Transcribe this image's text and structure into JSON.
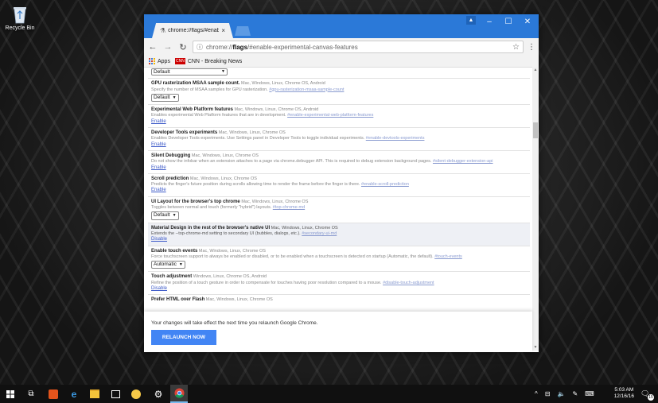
{
  "desktop": {
    "recycle_bin_label": "Recycle Bin"
  },
  "browser": {
    "tab_title": "chrome://flags/#enable",
    "url_prefix": "chrome://",
    "url_bold": "flags",
    "url_suffix": "/#enable-experimental-canvas-features",
    "bookmarks": {
      "apps_label": "Apps",
      "cnn_icon_text": "CNN",
      "cnn_label": "CNN - Breaking News"
    }
  },
  "flags": {
    "top_dropdown": "Default",
    "items": [
      {
        "name": "GPU rasterization MSAA sample count.",
        "platforms": "Mac, Windows, Linux, Chrome OS, Android",
        "desc": "Specify the number of MSAA samples for GPU rasterization.",
        "link": "#gpu-rasterization-msaa-sample-count",
        "control": "Default"
      },
      {
        "name": "Experimental Web Platform features",
        "platforms": "Mac, Windows, Linux, Chrome OS, Android",
        "desc": "Enables experimental Web Platform features that are in development.",
        "link": "#enable-experimental-web-platform-features",
        "action": "Enable"
      },
      {
        "name": "Developer Tools experiments",
        "platforms": "Mac, Windows, Linux, Chrome OS",
        "desc": "Enables Developer Tools experiments. Use Settings panel in Developer Tools to toggle individual experiments.",
        "link": "#enable-devtools-experiments",
        "action": "Enable"
      },
      {
        "name": "Silent Debugging",
        "platforms": "Mac, Windows, Linux, Chrome OS",
        "desc": "Do not show the infobar when an extension attaches to a page via chrome.debugger API. This is required to debug extension background pages.",
        "link": "#silent-debugger-extension-api",
        "action": "Enable"
      },
      {
        "name": "Scroll prediction",
        "platforms": "Mac, Windows, Linux, Chrome OS",
        "desc": "Predicts the finger's future position during scrolls allowing time to render the frame before the finger is there.",
        "link": "#enable-scroll-prediction",
        "action": "Enable"
      },
      {
        "name": "UI Layout for the browser's top chrome",
        "platforms": "Mac, Windows, Linux, Chrome OS",
        "desc": "Toggles between normal and touch (formerly \"hybrid\") layouts.",
        "link": "#top-chrome-md",
        "control": "Default"
      },
      {
        "name": "Material Design in the rest of the browser's native UI",
        "platforms": "Mac, Windows, Linux, Chrome OS",
        "desc": "Extends the --top-chrome-md setting to secondary UI (bubbles, dialogs, etc.).",
        "link": "#secondary-ui-md",
        "action": "Disable",
        "selected": true
      },
      {
        "name": "Enable touch events",
        "platforms": "Mac, Windows, Linux, Chrome OS",
        "desc": "Force touchscreen support to always be enabled or disabled, or to be enabled when a touchscreen is detected on startup (Automatic, the default).",
        "link": "#touch-events",
        "control": "Automatic"
      },
      {
        "name": "Touch adjustment",
        "platforms": "Windows, Linux, Chrome OS, Android",
        "desc": "Refine the position of a touch gesture in order to compensate for touches having poor resolution compared to a mouse.",
        "link": "#disable-touch-adjustment",
        "action": "Disable"
      },
      {
        "name": "Prefer HTML over Flash",
        "platforms": "Mac, Windows, Linux, Chrome OS",
        "desc": "",
        "link": ""
      }
    ]
  },
  "footer": {
    "message": "Your changes will take effect the next time you relaunch Google Chrome.",
    "relaunch_label": "RELAUNCH NOW"
  },
  "taskbar": {
    "time": "5:03 AM",
    "date": "12/16/16",
    "notification_count": "15"
  },
  "colors": {
    "titlebar": "#2b79d8",
    "relaunch": "#4285f4",
    "link": "#3d5ac8"
  }
}
